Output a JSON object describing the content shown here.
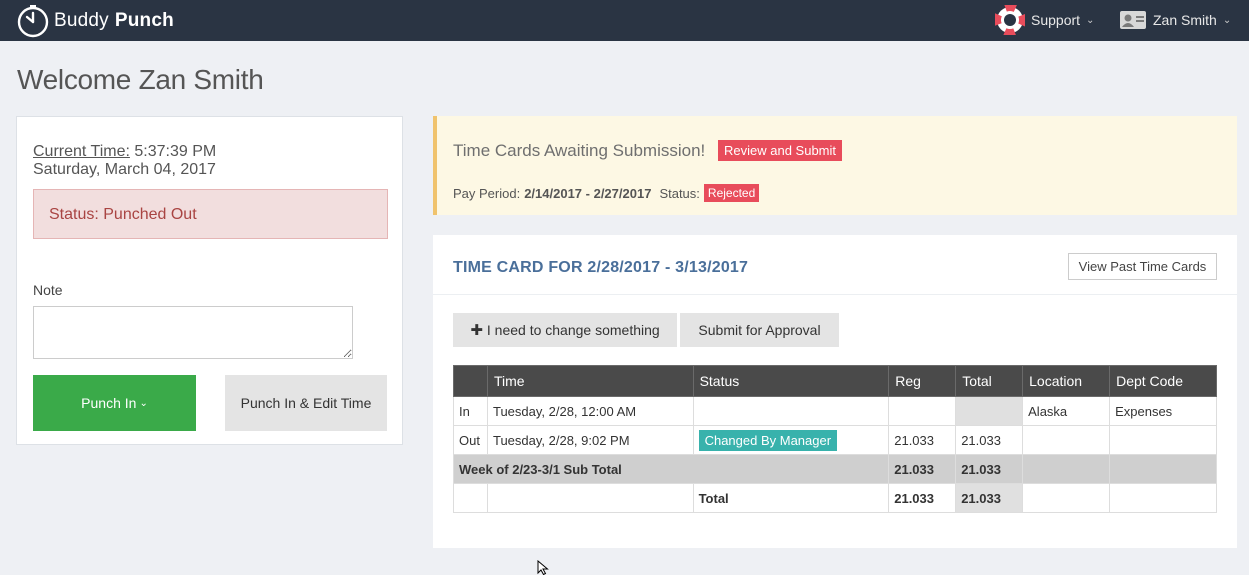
{
  "brand": {
    "name_light": "Buddy",
    "name_bold": "Punch"
  },
  "nav": {
    "support_label": "Support",
    "user_label": "Zan Smith"
  },
  "welcome": "Welcome Zan Smith",
  "clock": {
    "label": "Current Time:",
    "time": "5:37:39 PM",
    "date": "Saturday, March 04, 2017"
  },
  "status": "Status: Punched Out",
  "note": {
    "label": "Note",
    "value": ""
  },
  "buttons": {
    "punch_in": "Punch In",
    "punch_in_edit": "Punch In & Edit Time",
    "review_submit": "Review and Submit",
    "view_past": "View Past Time Cards",
    "change": "I need to change something",
    "submit_approval": "Submit for Approval"
  },
  "alert": {
    "title": "Time Cards Awaiting Submission!",
    "pay_period_label": "Pay Period:",
    "pay_period": "2/14/2017 - 2/27/2017",
    "status_label": "Status:",
    "status": "Rejected"
  },
  "timecard": {
    "title": "TIME CARD FOR 2/28/2017 - 3/13/2017",
    "headers": [
      "",
      "Time",
      "Status",
      "Reg",
      "Total",
      "Location",
      "Dept Code"
    ],
    "rows": [
      {
        "type": "In",
        "time": "Tuesday, 2/28, 12:00 AM",
        "status": "",
        "reg": "",
        "total": "",
        "location": "Alaska",
        "dept": "Expenses"
      },
      {
        "type": "Out",
        "time": "Tuesday, 2/28, 9:02 PM",
        "status": "Changed By Manager",
        "reg": "21.033",
        "total": "21.033",
        "location": "",
        "dept": ""
      }
    ],
    "subtotal": {
      "label": "Week of 2/23-3/1 Sub Total",
      "reg": "21.033",
      "total": "21.033"
    },
    "grand_total": {
      "label": "Total",
      "reg": "21.033",
      "total": "21.033"
    }
  },
  "colors": {
    "topbar": "#2a3443",
    "punch_green": "#3aaa49",
    "alert_red": "#e84c5b",
    "badge_teal": "#38b2ac",
    "title_blue": "#4a6f9a"
  }
}
